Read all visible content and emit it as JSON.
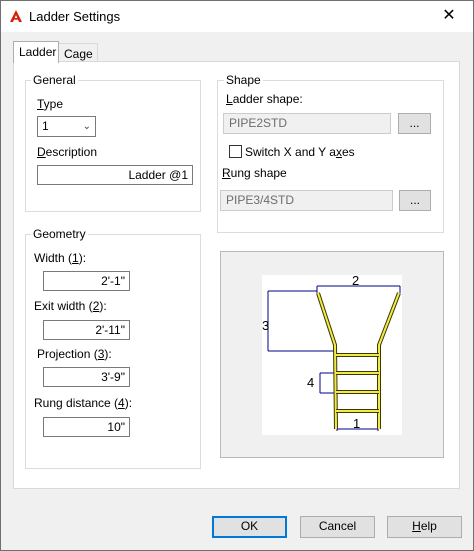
{
  "window": {
    "title": "Ladder Settings",
    "close_glyph": "✕"
  },
  "tabs": [
    {
      "label": "Ladder"
    },
    {
      "label": "Cage"
    }
  ],
  "general": {
    "group_label": "General",
    "type_label": "Type",
    "type_value": "1",
    "description_label": "Description",
    "description_value": "Ladder @1"
  },
  "shape": {
    "group_label": "Shape",
    "ladder_shape_label": "Ladder shape:",
    "ladder_shape_value": "PIPE2STD",
    "browse_label": "...",
    "switch_label": "Switch X and Y axes",
    "switch_checked": false,
    "rung_shape_label": "Rung shape",
    "rung_shape_value": "PIPE3/4STD",
    "browse_label_2": "..."
  },
  "geometry": {
    "group_label": "Geometry",
    "width_label": "Width (1):",
    "width_value": "2'-1\"",
    "exit_width_label": "Exit width (2):",
    "exit_width_value": "2'-11\"",
    "projection_label": "Projection (3):",
    "projection_value": "3'-9\"",
    "rung_distance_label": "Rung distance (4):",
    "rung_distance_value": "10\""
  },
  "diagram": {
    "label_1": "1",
    "label_2": "2",
    "label_3": "3",
    "label_4": "4"
  },
  "buttons": {
    "ok": "OK",
    "cancel": "Cancel",
    "help": "Help"
  }
}
